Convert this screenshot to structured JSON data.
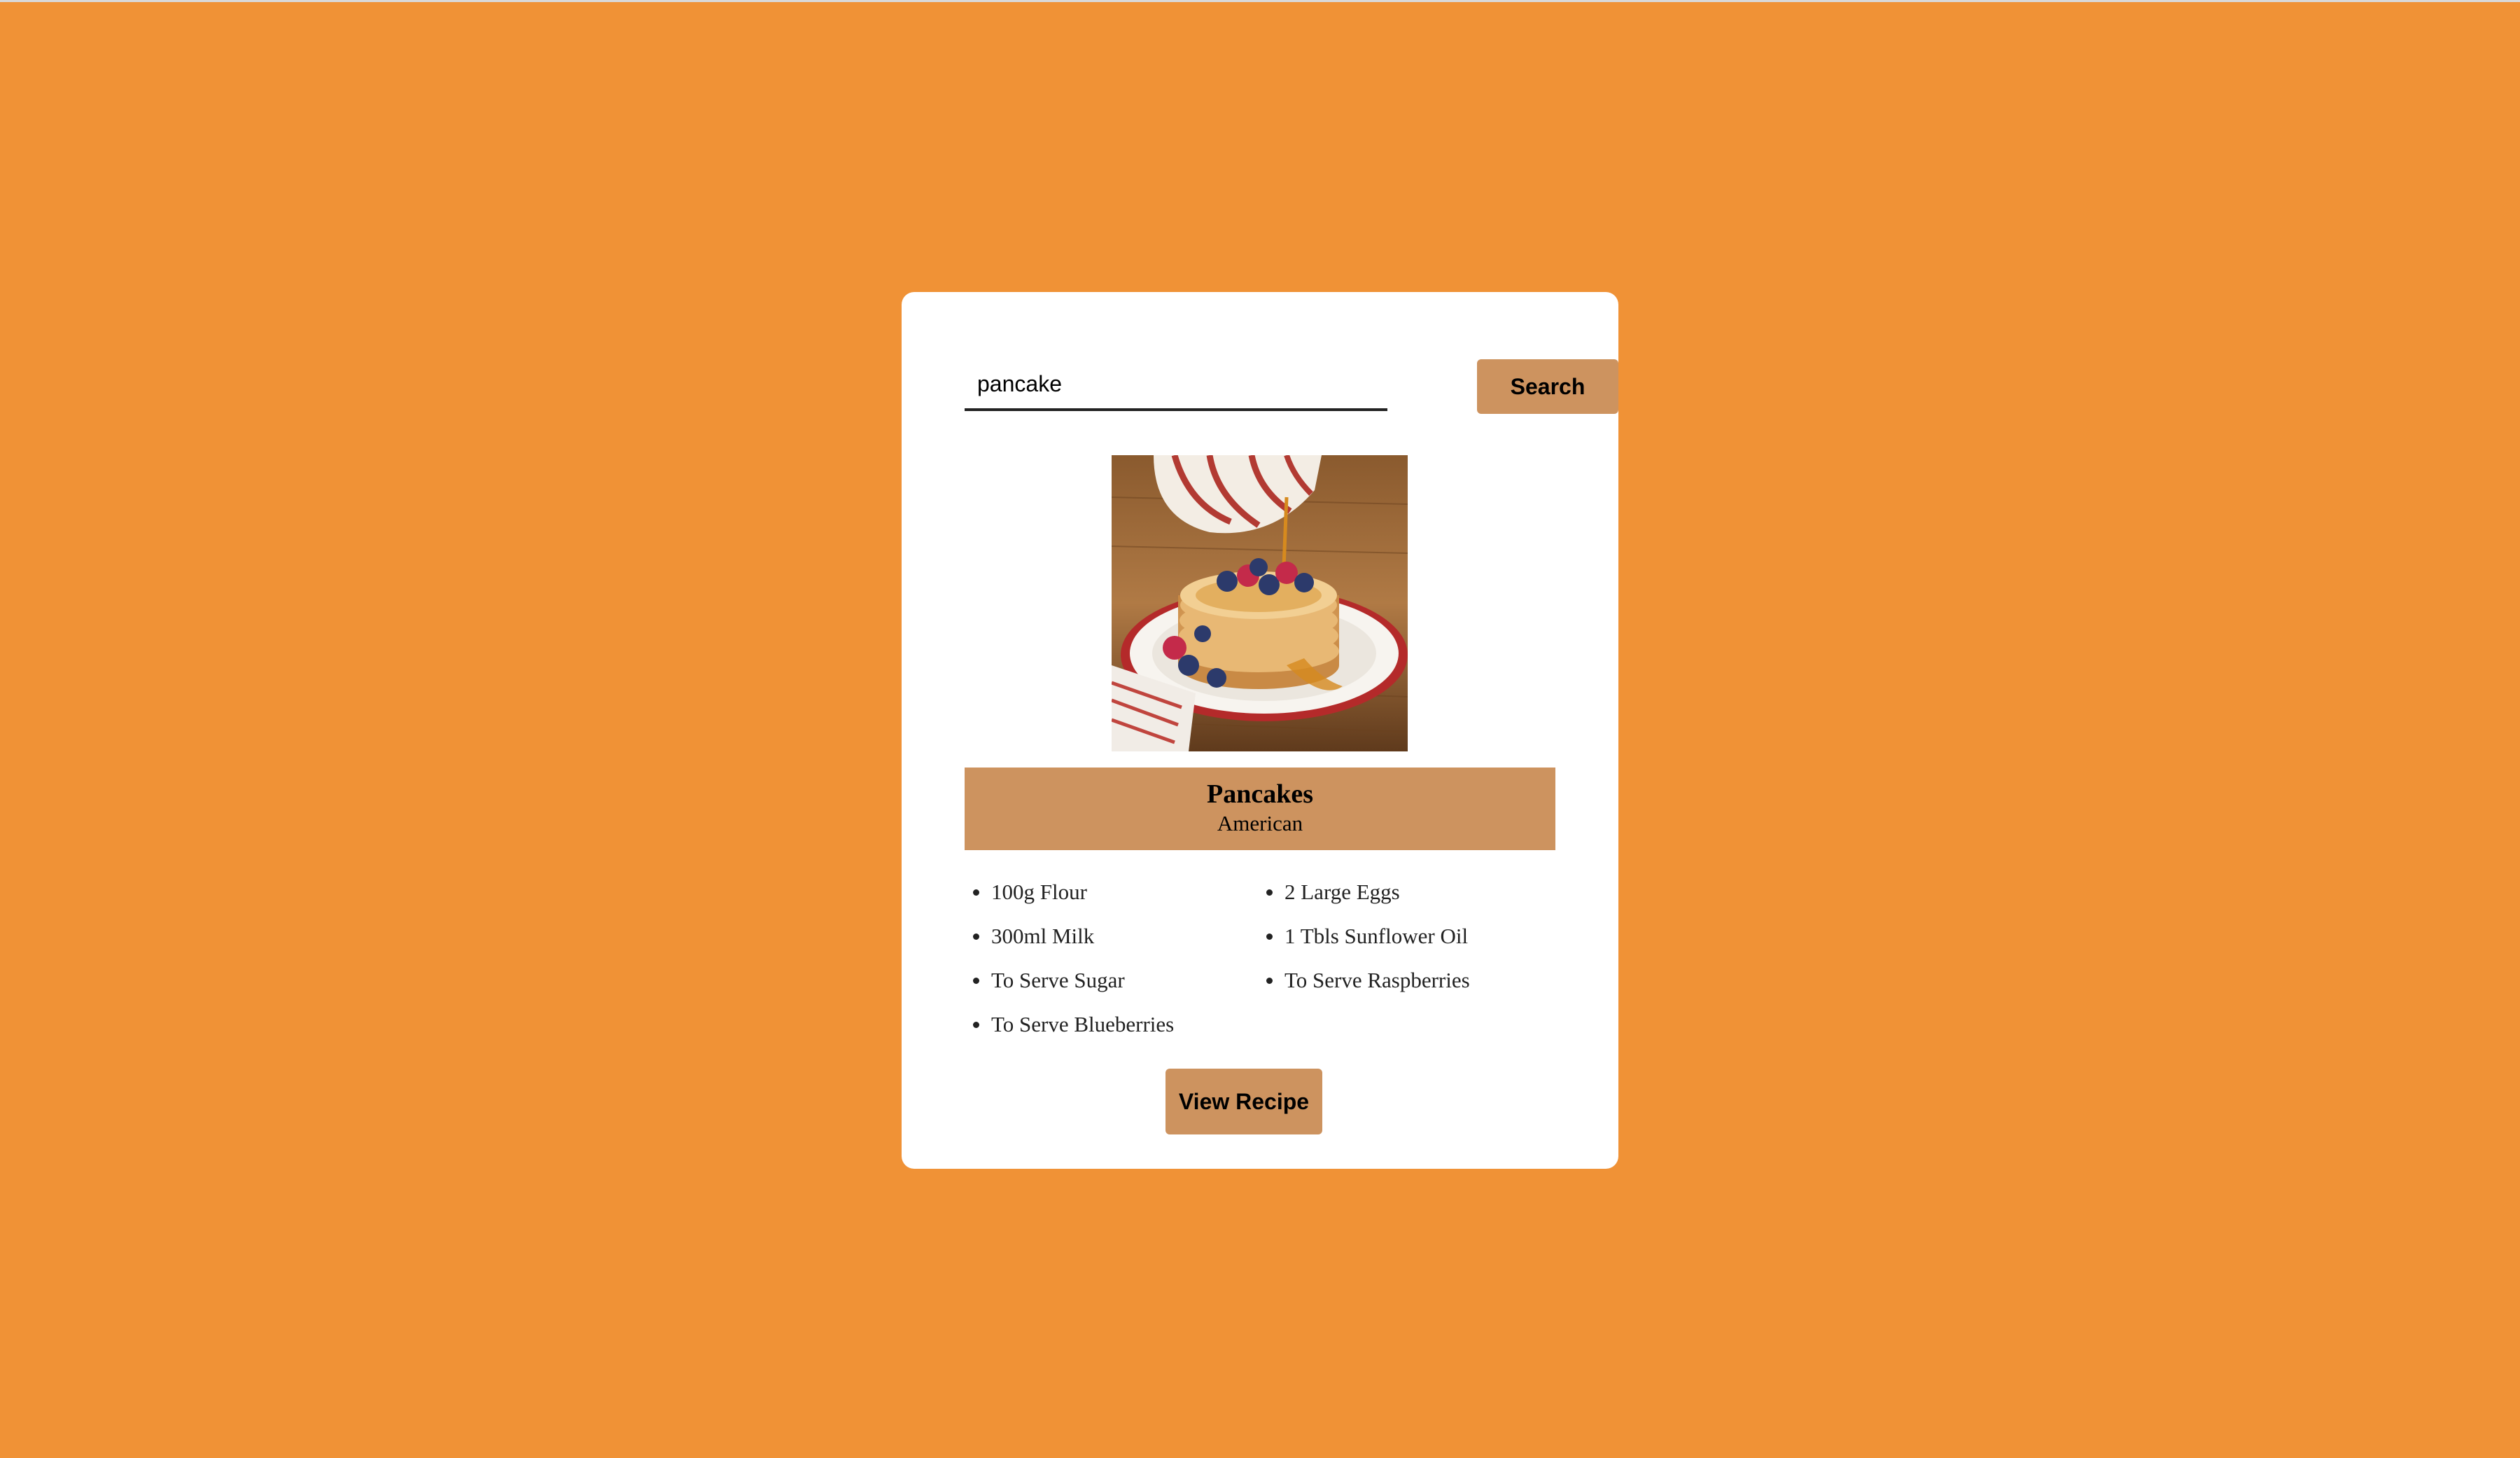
{
  "search": {
    "value": "pancake",
    "button_label": "Search"
  },
  "meal": {
    "image_icon": "pancake-stack-photo",
    "name": "Pancakes",
    "area": "American",
    "ingredients": [
      "100g Flour",
      "2 Large Eggs",
      "300ml Milk",
      "1 Tbls Sunflower Oil",
      "To Serve Sugar",
      "To Serve Raspberries",
      "To Serve Blueberries"
    ],
    "view_button_label": "View Recipe"
  },
  "colors": {
    "background": "#f09236",
    "card": "#ffffff",
    "accent": "#cd935f"
  }
}
